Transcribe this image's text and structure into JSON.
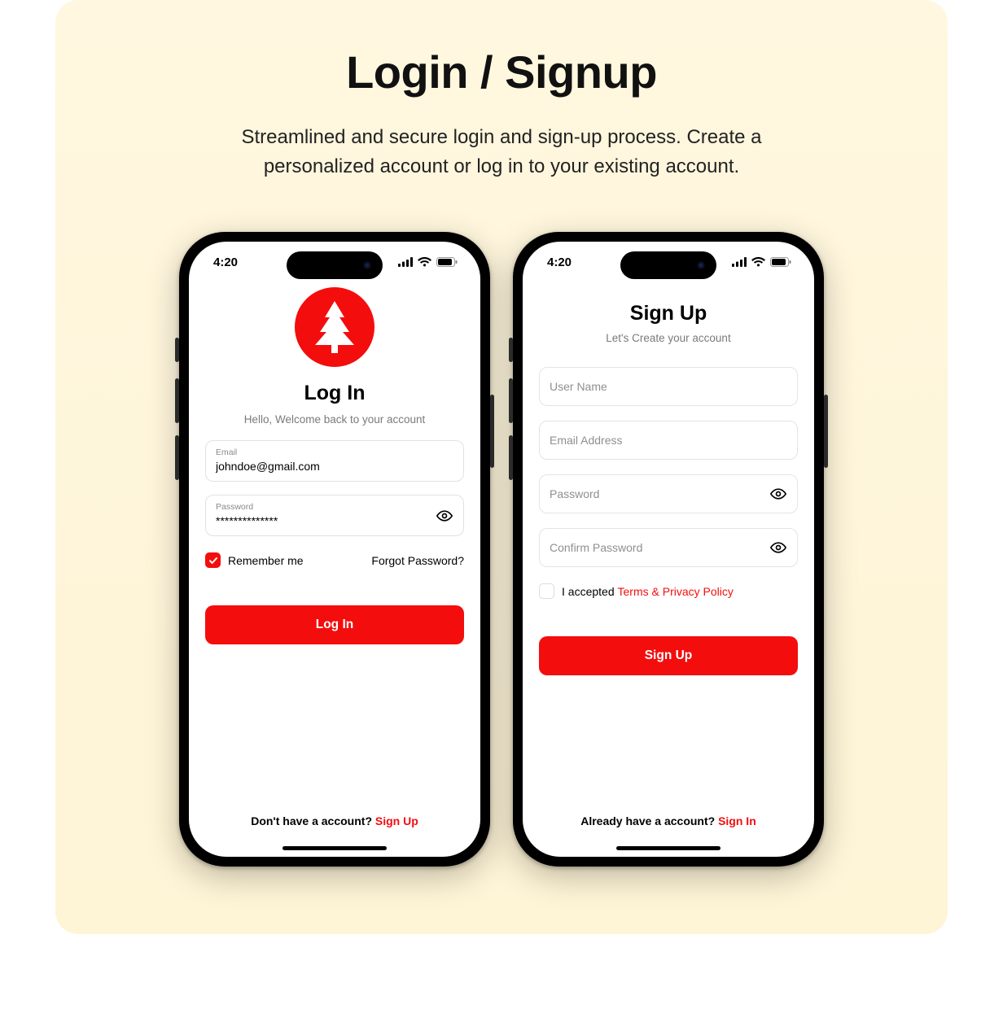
{
  "header": {
    "title": "Login / Signup",
    "subtitle": "Streamlined and secure login and sign-up process. Create a personalized account or log in to your existing account."
  },
  "status": {
    "time": "4:20"
  },
  "login": {
    "heading": "Log In",
    "subheading": "Hello, Welcome back to your account",
    "email_label": "Email",
    "email_value": "johndoe@gmail.com",
    "password_label": "Password",
    "password_value": "**************",
    "remember": "Remember me",
    "forgot": "Forgot Password?",
    "button": "Log In",
    "footer_prefix": "Don't have a account? ",
    "footer_action": "Sign Up"
  },
  "signup": {
    "heading": "Sign Up",
    "subheading": "Let's Create your account",
    "username_ph": "User Name",
    "email_ph": "Email Address",
    "pw_ph": "Password",
    "cpw_ph": "Confirm Password",
    "terms_prefix": "I accepted ",
    "terms_link": "Terms & Privacy Policy",
    "button": "Sign Up",
    "footer_prefix": "Already have a account? ",
    "footer_action": "Sign In"
  }
}
